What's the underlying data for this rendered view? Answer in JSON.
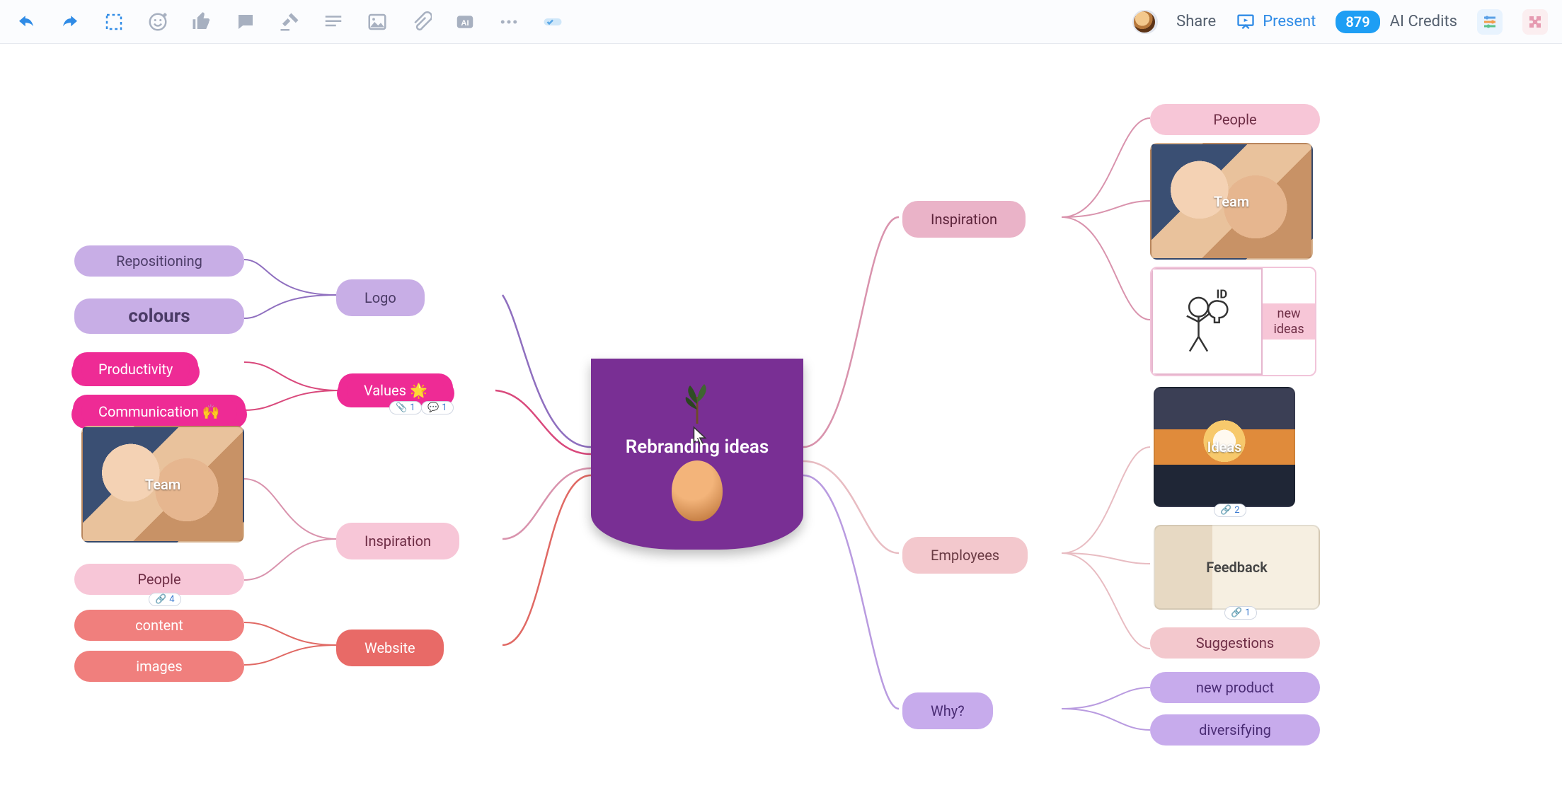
{
  "toolbar": {
    "share": "Share",
    "present": "Present",
    "credits_number": "879",
    "credits_label": "AI Credits"
  },
  "central": {
    "title": "Rebranding ideas"
  },
  "left": {
    "logo": {
      "label": "Logo",
      "children": {
        "repositioning": "Repositioning",
        "colours": "colours"
      }
    },
    "values": {
      "label": "Values 🌟",
      "children": {
        "productivity": "Productivity",
        "communication": "Communication 🙌"
      },
      "attach_badge": "1",
      "comment_badge": "1"
    },
    "inspiration": {
      "label": "Inspiration",
      "children": {
        "team": "Team",
        "people": "People"
      },
      "people_badge": "4"
    },
    "website": {
      "label": "Website",
      "children": {
        "content": "content",
        "images": "images"
      }
    }
  },
  "right": {
    "inspiration": {
      "label": "Inspiration",
      "children": {
        "people": "People",
        "team": "Team",
        "new_ideas": "new ideas"
      }
    },
    "employees": {
      "label": "Employees",
      "children": {
        "ideas": "Ideas",
        "ideas_badge": "2",
        "feedback": "Feedback",
        "feedback_badge": "1",
        "suggestions": "Suggestions"
      }
    },
    "why": {
      "label": "Why?",
      "children": {
        "new_product": "new product",
        "diversifying": "diversifying"
      }
    }
  }
}
